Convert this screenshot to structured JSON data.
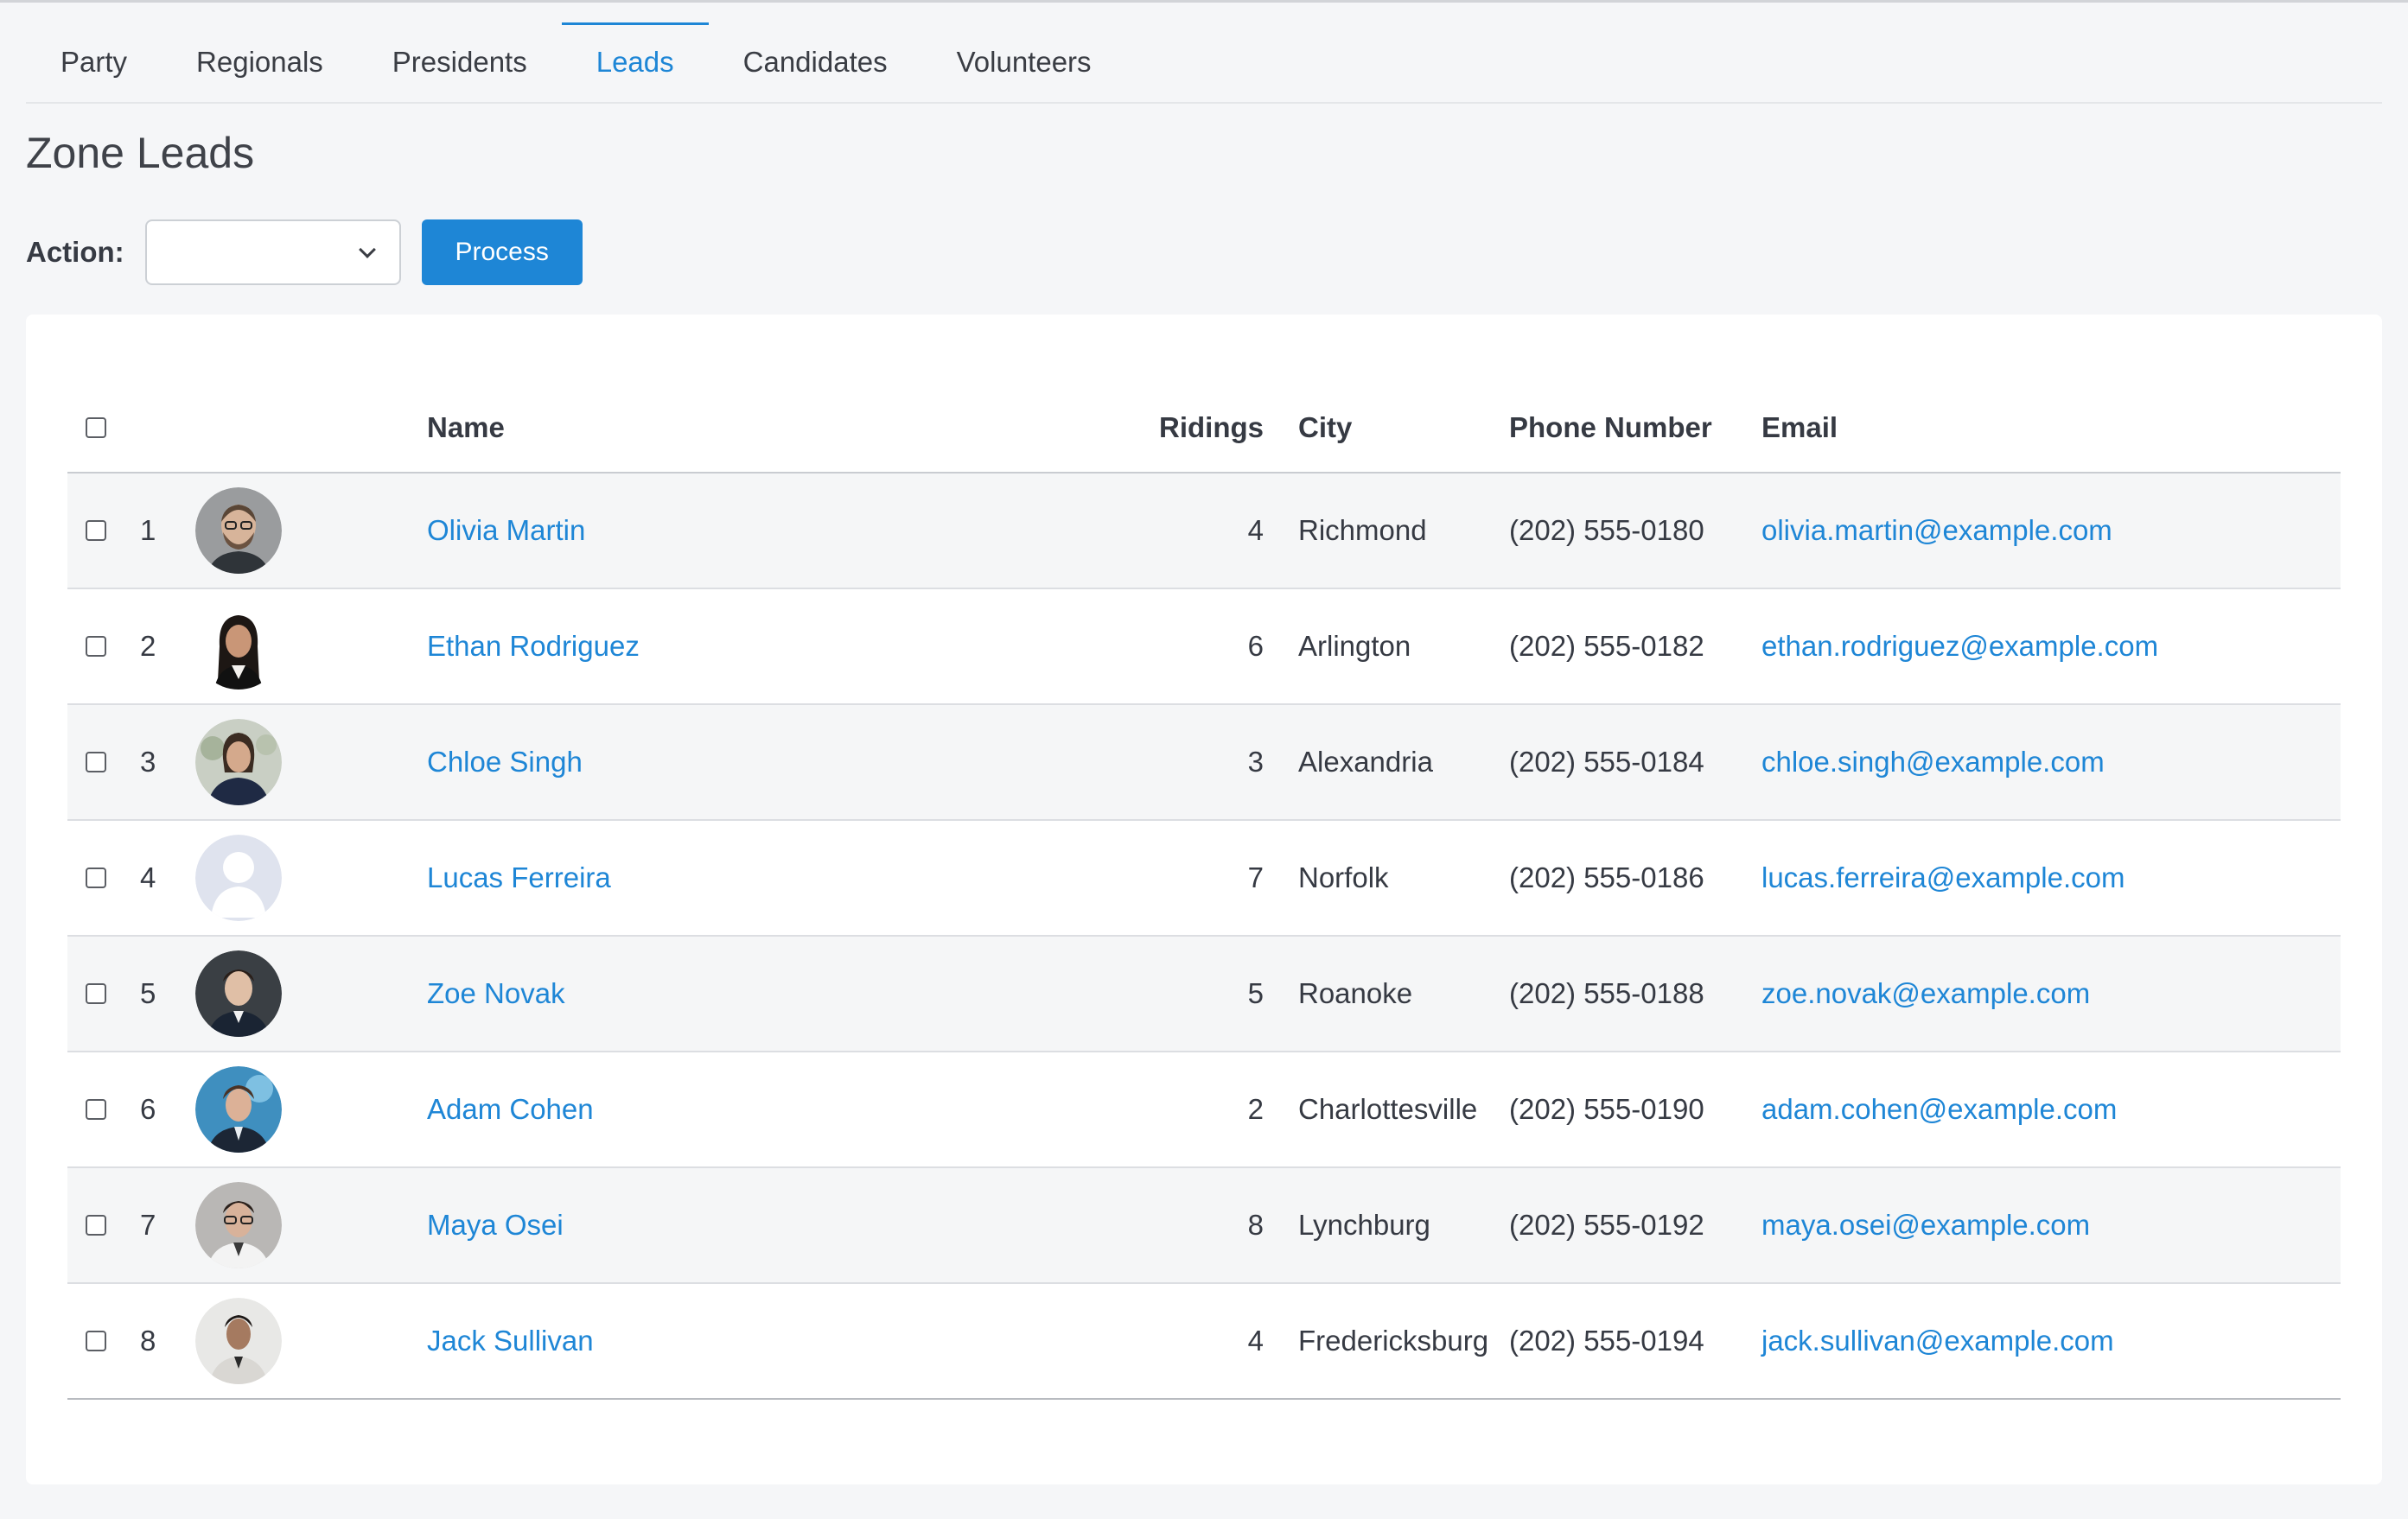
{
  "tabs": [
    {
      "label": "Party",
      "active": false
    },
    {
      "label": "Regionals",
      "active": false
    },
    {
      "label": "Presidents",
      "active": false
    },
    {
      "label": "Leads",
      "active": true
    },
    {
      "label": "Candidates",
      "active": false
    },
    {
      "label": "Volunteers",
      "active": false
    }
  ],
  "page_title": "Zone Leads",
  "action": {
    "label": "Action:",
    "selected": "",
    "process_label": "Process"
  },
  "table": {
    "headers": {
      "name": "Name",
      "ridings": "Ridings",
      "city": "City",
      "phone": "Phone Number",
      "email": "Email"
    },
    "rows": [
      {
        "num": "1",
        "name": "Olivia Martin",
        "ridings": "4",
        "city": "Richmond",
        "phone": "(202) 555-0180",
        "email": "olivia.martin@example.com",
        "avatar": "man-beard-glasses"
      },
      {
        "num": "2",
        "name": "Ethan Rodriguez",
        "ridings": "6",
        "city": "Arlington",
        "phone": "(202) 555-0182",
        "email": "ethan.rodriguez@example.com",
        "avatar": "woman-dark-hair"
      },
      {
        "num": "3",
        "name": "Chloe Singh",
        "ridings": "3",
        "city": "Alexandria",
        "phone": "(202) 555-0184",
        "email": "chloe.singh@example.com",
        "avatar": "woman-navy-outdoor"
      },
      {
        "num": "4",
        "name": "Lucas Ferreira",
        "ridings": "7",
        "city": "Norfolk",
        "phone": "(202) 555-0186",
        "email": "lucas.ferreira@example.com",
        "avatar": "placeholder-silhouette"
      },
      {
        "num": "5",
        "name": "Zoe Novak",
        "ridings": "5",
        "city": "Roanoke",
        "phone": "(202) 555-0188",
        "email": "zoe.novak@example.com",
        "avatar": "man-dark-background"
      },
      {
        "num": "6",
        "name": "Adam Cohen",
        "ridings": "2",
        "city": "Charlottesville",
        "phone": "(202) 555-0190",
        "email": "adam.cohen@example.com",
        "avatar": "man-blue-background"
      },
      {
        "num": "7",
        "name": "Maya Osei",
        "ridings": "8",
        "city": "Lynchburg",
        "phone": "(202) 555-0192",
        "email": "maya.osei@example.com",
        "avatar": "man-white-jacket"
      },
      {
        "num": "8",
        "name": "Jack Sullivan",
        "ridings": "4",
        "city": "Fredericksburg",
        "phone": "(202) 555-0194",
        "email": "jack.sullivan@example.com",
        "avatar": "man-light-suit"
      }
    ]
  },
  "colors": {
    "accent": "#1e86d6",
    "background": "#f5f6f8",
    "card": "#ffffff",
    "text": "#363a43"
  }
}
